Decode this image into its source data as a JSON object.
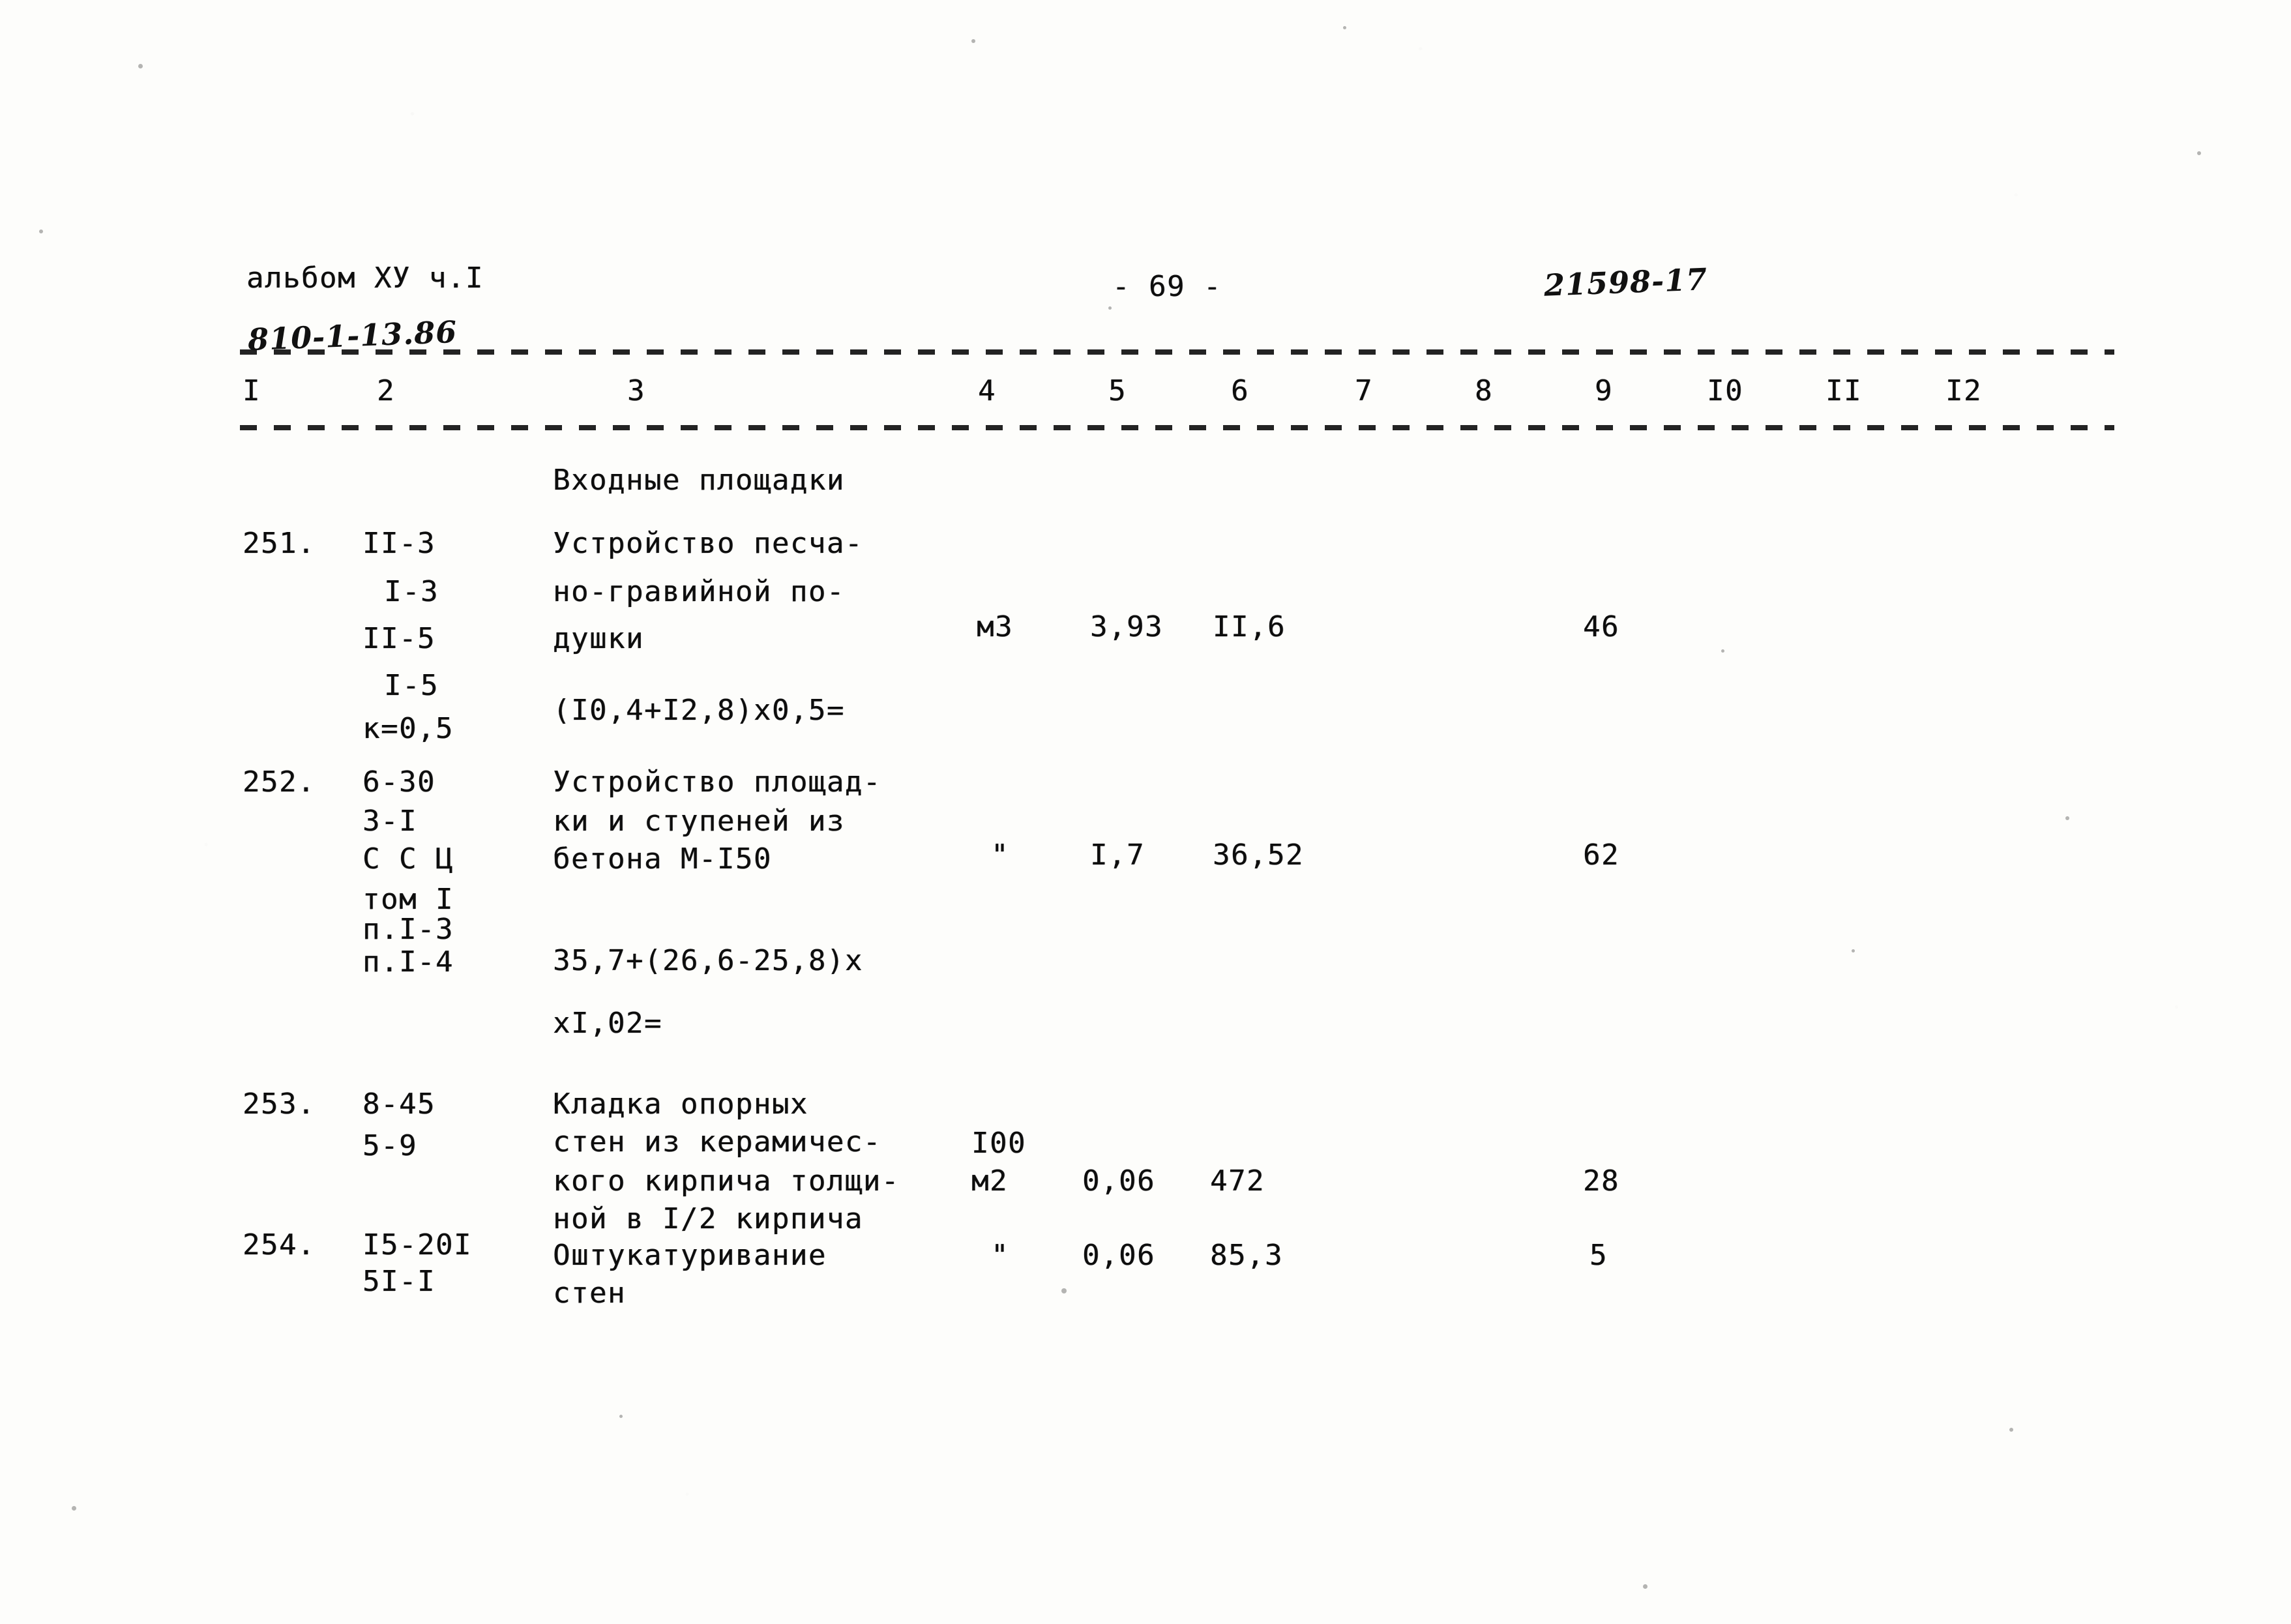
{
  "document": {
    "kind": "scanned-typewritten-estimate-table",
    "language": "ru"
  },
  "header": {
    "album_label": "альбом ХУ ч.I",
    "album_code_handwritten": "810-1-13.86",
    "page_number": "- 69 -",
    "sheet_code_handwritten": "21598-17"
  },
  "table": {
    "column_headers": [
      "I",
      "2",
      "3",
      "4",
      "5",
      "6",
      "7",
      "8",
      "9",
      "I0",
      "II",
      "I2"
    ],
    "section_title": "Входные площадки",
    "rows": [
      {
        "num": "251.",
        "codes": [
          "II-3",
          "I-3",
          "II-5",
          "I-5",
          "к=0,5"
        ],
        "description": [
          "Устройство песча-",
          "но-гравийной по-",
          "душки"
        ],
        "formula": "(I0,4+I2,8)x0,5=",
        "unit": "м3",
        "col5": "3,93",
        "col6": "II,6",
        "col9": "46"
      },
      {
        "num": "252.",
        "codes": [
          "6-30",
          "3-I",
          "С С Ц",
          "том I",
          "п.I-3",
          "п.I-4"
        ],
        "description": [
          "Устройство площад-",
          "ки и ступеней из",
          "бетона М-I50"
        ],
        "formula": "35,7+(26,6-25,8)x",
        "formula2": "xI,02=",
        "unit": "\"",
        "col5": "I,7",
        "col6": "36,52",
        "col9": "62"
      },
      {
        "num": "253.",
        "codes": [
          "8-45",
          "5-9"
        ],
        "description": [
          "Кладка опорных",
          "стен из керамичес-",
          "кого кирпича толщи-",
          "ной в I/2 кирпича"
        ],
        "formula": "",
        "unit_top": "I00",
        "unit": "м2",
        "col5": "0,06",
        "col6": "472",
        "col9": "28"
      },
      {
        "num": "254.",
        "codes": [
          "I5-20I",
          "5I-I"
        ],
        "description": [
          "Оштукатуривание",
          "стен"
        ],
        "formula": "",
        "unit": "\"",
        "col5": "0,06",
        "col6": "85,3",
        "col9": "5"
      }
    ]
  }
}
